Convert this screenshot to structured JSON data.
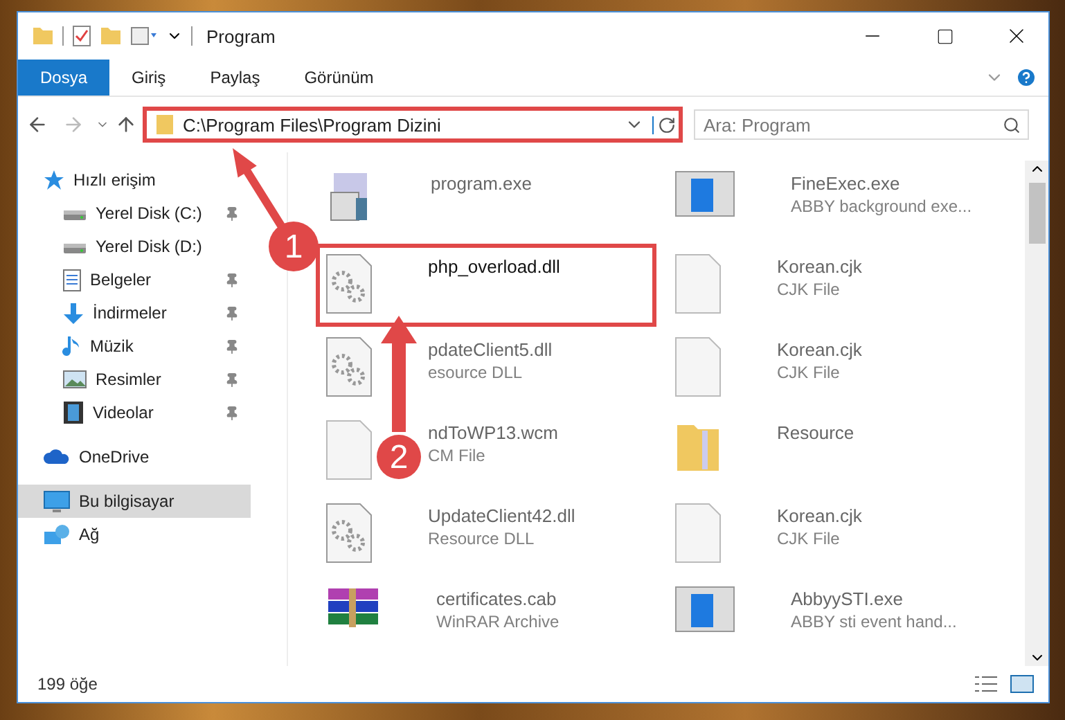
{
  "window": {
    "title": "Program"
  },
  "ribbon_tabs": [
    {
      "label": "Dosya",
      "selected": true
    },
    {
      "label": "Giriş",
      "selected": false
    },
    {
      "label": "Paylaş",
      "selected": false
    },
    {
      "label": "Görünüm",
      "selected": false
    }
  ],
  "address": {
    "path": "C:\\Program Files\\Program Dizini",
    "highlighted": true
  },
  "search": {
    "placeholder": "Ara: Program"
  },
  "nav": [
    {
      "label": "Hızlı erişim",
      "kind": "star",
      "selected": false,
      "children": [
        {
          "label": "Yerel Disk (C:)",
          "kind": "drive",
          "pinned": true,
          "selected": false
        },
        {
          "label": "Yerel Disk (D:)",
          "kind": "drive",
          "pinned": false,
          "selected": false
        },
        {
          "label": "Belgeler",
          "kind": "doc",
          "pinned": true,
          "selected": false
        },
        {
          "label": "İndirmeler",
          "kind": "download",
          "pinned": true,
          "selected": false
        },
        {
          "label": "Müzik",
          "kind": "music",
          "pinned": true,
          "selected": false
        },
        {
          "label": "Resimler",
          "kind": "picture",
          "pinned": true,
          "selected": false
        },
        {
          "label": "Videolar",
          "kind": "video",
          "pinned": true,
          "selected": false
        }
      ]
    },
    {
      "label": "OneDrive",
      "kind": "cloud",
      "selected": false
    },
    {
      "label": "Bu bilgisayar",
      "kind": "computer",
      "selected": true
    },
    {
      "label": "Ağ",
      "kind": "network",
      "selected": false
    }
  ],
  "files": [
    {
      "name": "program.exe",
      "kind": "exe",
      "highlighted": false
    },
    {
      "name": "FineExec.exe",
      "type": "ABBY background exe...",
      "kind": "app",
      "highlighted": false
    },
    {
      "name": "php_overload.dll",
      "kind": "dll",
      "highlighted": true
    },
    {
      "name": "Korean.cjk",
      "type": "CJK File",
      "kind": "blank",
      "highlighted": false
    },
    {
      "name": "pdateClient5.dll",
      "type": "esource DLL",
      "kind": "dll",
      "highlighted": false
    },
    {
      "name": "Korean.cjk",
      "type": "CJK File",
      "kind": "blank",
      "highlighted": false
    },
    {
      "name": "ndToWP13.wcm",
      "type": "CM File",
      "kind": "blank",
      "highlighted": false
    },
    {
      "name": "Resource",
      "kind": "folder",
      "highlighted": false
    },
    {
      "name": "UpdateClient42.dll",
      "type": "Resource DLL",
      "kind": "dll",
      "highlighted": false
    },
    {
      "name": "Korean.cjk",
      "type": "CJK File",
      "kind": "blank",
      "highlighted": false
    },
    {
      "name": "certificates.cab",
      "type": "WinRAR Archive",
      "kind": "archive",
      "highlighted": false
    },
    {
      "name": "AbbyySTI.exe",
      "type": "ABBY sti event hand...",
      "kind": "app",
      "highlighted": false
    }
  ],
  "status_bar": {
    "count": "199 öğe"
  },
  "callouts": [
    {
      "number": "1"
    },
    {
      "number": "2"
    }
  ]
}
